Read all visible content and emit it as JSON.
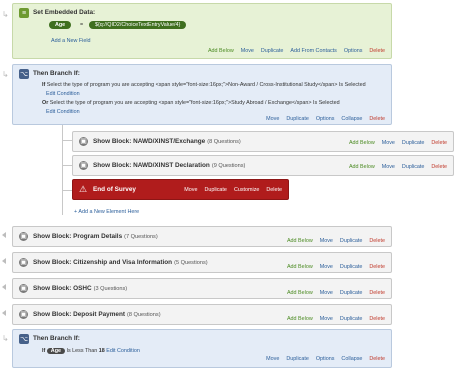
{
  "embedded": {
    "title": "Set Embedded Data:",
    "field": "Age",
    "equals": "=",
    "value": "${q://QID2/ChoiceTextEntryValue/4}",
    "add_field": "Add a New Field",
    "actions": [
      "Add Below",
      "Move",
      "Duplicate",
      "Add From Contacts",
      "Options",
      "Delete"
    ]
  },
  "branch1": {
    "title": "Then Branch If:",
    "if_label": "If",
    "cond1_text": "Select the type of program you are accepting  <span style=\"font-size:16px;\">Non-Award / Cross-Institutional Study</span>",
    "cond1_tail": "Is Selected",
    "edit1": "Edit Condition",
    "or_label": "Or",
    "cond2_text": "Select the type of program you are accepting  <span style=\"font-size:16px;\">Study Abroad / Exchange</span>",
    "cond2_tail": "Is Selected",
    "edit2": "Edit Condition",
    "actions": [
      "Move",
      "Duplicate",
      "Options",
      "Collapse",
      "Delete"
    ]
  },
  "nested": {
    "block1": {
      "title": "Show Block: NAWD/XINST/Exchange",
      "sub": "(8 Questions)"
    },
    "block2": {
      "title": "Show Block: NAWD/XINST Declaration",
      "sub": "(9 Questions)"
    },
    "block_actions": [
      "Add Below",
      "Move",
      "Duplicate",
      "Delete"
    ],
    "eos": {
      "title": "End of Survey",
      "actions": [
        "Move",
        "Duplicate",
        "Customize",
        "Delete"
      ]
    },
    "add_element": "Add a New Element Here"
  },
  "blocks": [
    {
      "title": "Show Block: Program Details",
      "sub": "(7 Questions)"
    },
    {
      "title": "Show Block: Citizenship and Visa Information",
      "sub": "(5 Questions)"
    },
    {
      "title": "Show Block: OSHC",
      "sub": "(3 Questions)"
    },
    {
      "title": "Show Block: Deposit Payment",
      "sub": "(8 Questions)"
    }
  ],
  "block_actions": [
    "Add Below",
    "Move",
    "Duplicate",
    "Delete"
  ],
  "branch2": {
    "title": "Then Branch If:",
    "if_label": "If",
    "field": "Age",
    "operator": "Is Less Than",
    "value": "18",
    "edit": "Edit Condition",
    "actions": [
      "Move",
      "Duplicate",
      "Options",
      "Collapse",
      "Delete"
    ]
  },
  "colors": {
    "embed_bg": "#e7f2d6",
    "branch_bg": "#e4ecf7",
    "block_bg": "#f3f3f3",
    "end_of_survey": "#b01c1c",
    "link": "#2b5e9a",
    "add_link": "#4b8b22",
    "delete_link": "#c0392b"
  }
}
